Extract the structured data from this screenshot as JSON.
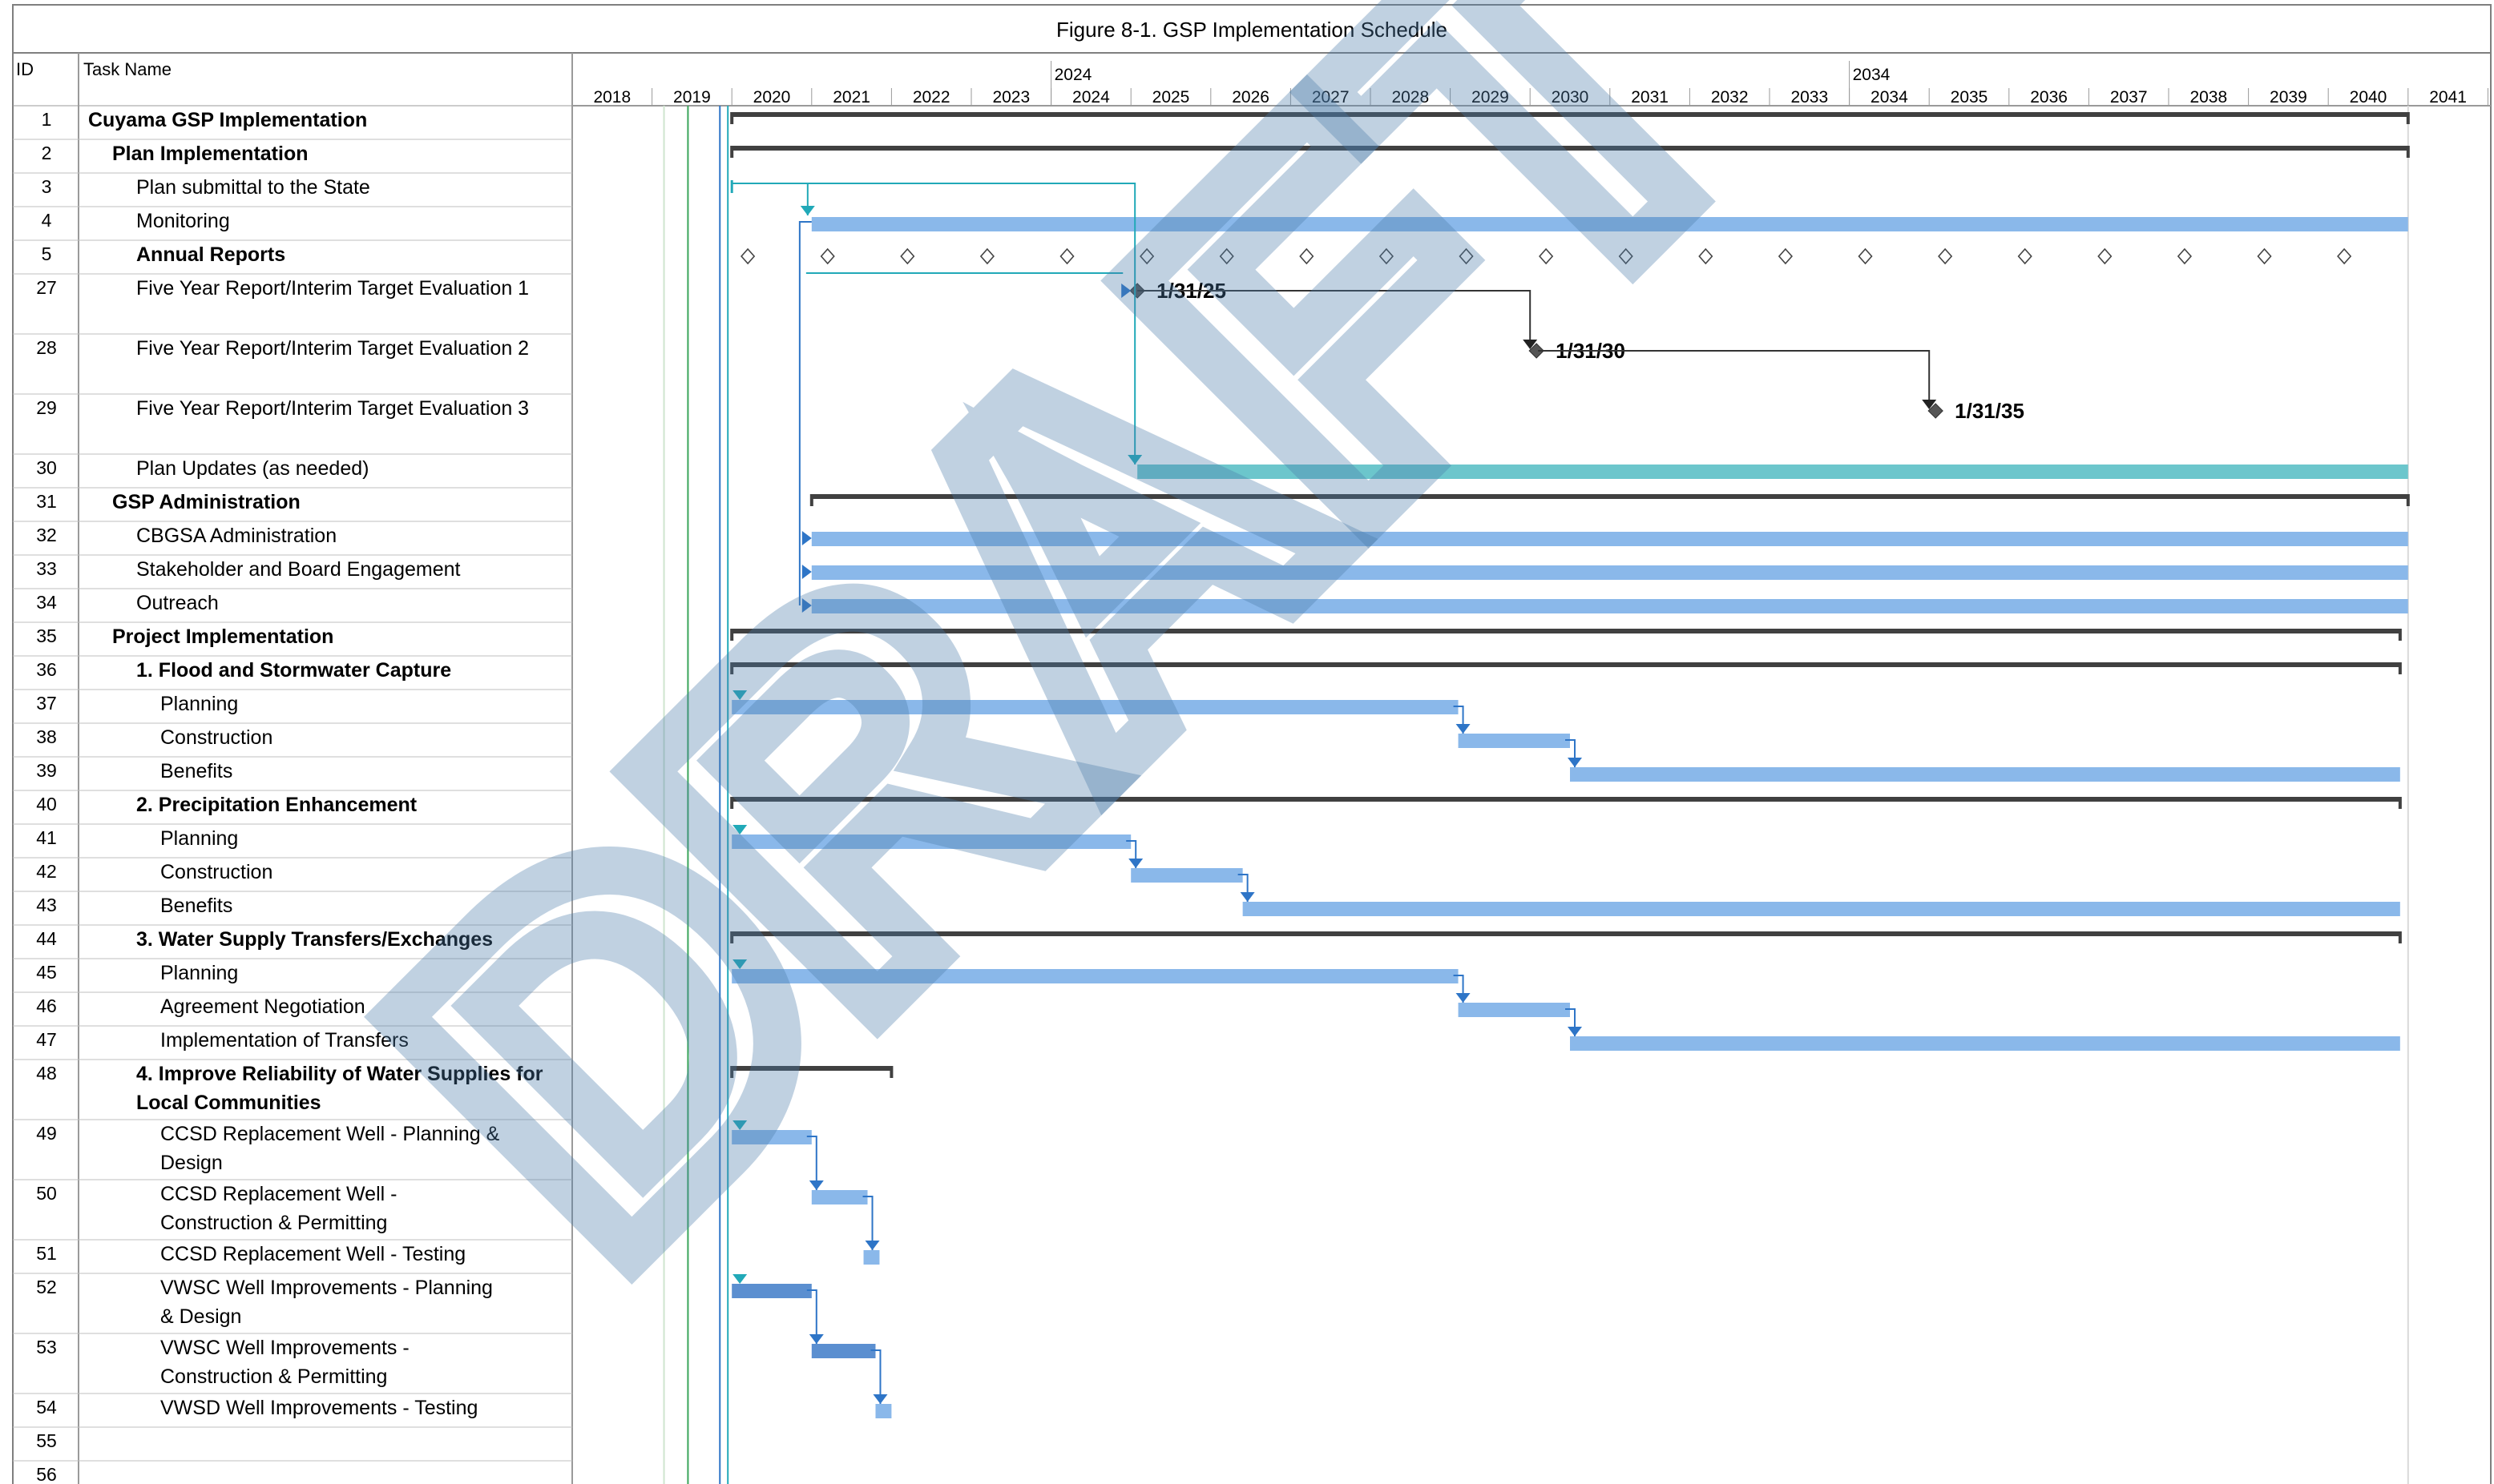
{
  "title": "Figure 8-1. GSP Implementation Schedule",
  "columns": {
    "id": "ID",
    "task_name": "Task Name"
  },
  "timescale": {
    "major": [
      "2024",
      "2034"
    ],
    "years": [
      "2018",
      "2019",
      "2020",
      "2021",
      "2022",
      "2023",
      "2024",
      "2025",
      "2026",
      "2027",
      "2028",
      "2029",
      "2030",
      "2031",
      "2032",
      "2033",
      "2034",
      "2035",
      "2036",
      "2037",
      "2038",
      "2039",
      "2040",
      "2041"
    ]
  },
  "watermark": "DRAFT",
  "colors": {
    "task_bar": "#8ab8ea",
    "task_bar_dark": "#5b8fd0",
    "plan_updates_bar": "#6cc6cc",
    "summary_bar": "#404040",
    "link_blue": "#2e75c7",
    "link_teal": "#21a9b8",
    "milestone": "#555555",
    "watermark": "#4a7aa8",
    "grid": "#bfbfbf"
  },
  "chart_data": {
    "type": "gantt",
    "title": "Figure 8-1. GSP Implementation Schedule",
    "x_range": [
      2018,
      2042
    ],
    "tasks": [
      {
        "id": "1",
        "name": "Cuyama GSP Implementation",
        "bold": true,
        "indent": 0,
        "kind": "summary",
        "start": 2020.0,
        "end": 2041.0
      },
      {
        "id": "2",
        "name": "Plan Implementation",
        "bold": true,
        "indent": 1,
        "kind": "summary",
        "start": 2020.0,
        "end": 2041.0
      },
      {
        "id": "3",
        "name": "Plan submittal to the State",
        "bold": false,
        "indent": 2,
        "kind": "milestone",
        "start": 2020.0,
        "end": 2020.0
      },
      {
        "id": "4",
        "name": "Monitoring",
        "bold": false,
        "indent": 2,
        "kind": "task",
        "start": 2021.0,
        "end": 2041.0
      },
      {
        "id": "5",
        "name": "Annual Reports",
        "bold": true,
        "indent": 2,
        "kind": "recurring",
        "dates": [
          2020.2,
          2021.2,
          2022.2,
          2023.2,
          2024.2,
          2025.2,
          2026.2,
          2027.2,
          2028.2,
          2029.2,
          2030.2,
          2031.2,
          2032.2,
          2033.2,
          2034.2,
          2035.2,
          2036.2,
          2037.2,
          2038.2,
          2039.2,
          2040.2
        ]
      },
      {
        "id": "27",
        "name": "Five Year Report/Interim Target Evaluation 1",
        "bold": false,
        "indent": 2,
        "kind": "milestone",
        "start": 2025.08,
        "end": 2025.08,
        "label": "1/31/25"
      },
      {
        "id": "28",
        "name": "Five Year Report/Interim Target Evaluation 2",
        "bold": false,
        "indent": 2,
        "kind": "milestone",
        "start": 2030.08,
        "end": 2030.08,
        "label": "1/31/30"
      },
      {
        "id": "29",
        "name": "Five Year Report/Interim Target Evaluation 3",
        "bold": false,
        "indent": 2,
        "kind": "milestone",
        "start": 2035.08,
        "end": 2035.08,
        "label": "1/31/35"
      },
      {
        "id": "30",
        "name": "Plan Updates (as needed)",
        "bold": false,
        "indent": 2,
        "kind": "task",
        "start": 2025.08,
        "end": 2041.0,
        "color": "teal"
      },
      {
        "id": "31",
        "name": "GSP Administration",
        "bold": true,
        "indent": 1,
        "kind": "summary",
        "start": 2021.0,
        "end": 2041.0
      },
      {
        "id": "32",
        "name": "CBGSA Administration",
        "bold": false,
        "indent": 2,
        "kind": "task",
        "start": 2021.0,
        "end": 2041.0
      },
      {
        "id": "33",
        "name": "Stakeholder and Board Engagement",
        "bold": false,
        "indent": 2,
        "kind": "task",
        "start": 2021.0,
        "end": 2041.0
      },
      {
        "id": "34",
        "name": "Outreach",
        "bold": false,
        "indent": 2,
        "kind": "task",
        "start": 2021.0,
        "end": 2041.0
      },
      {
        "id": "35",
        "name": "Project Implementation",
        "bold": true,
        "indent": 1,
        "kind": "summary",
        "start": 2020.0,
        "end": 2040.9
      },
      {
        "id": "36",
        "name": "1. Flood and Stormwater Capture",
        "bold": true,
        "indent": 2,
        "kind": "summary",
        "start": 2020.0,
        "end": 2040.9
      },
      {
        "id": "37",
        "name": "Planning",
        "bold": false,
        "indent": 3,
        "kind": "task",
        "start": 2020.0,
        "end": 2029.1
      },
      {
        "id": "38",
        "name": "Construction",
        "bold": false,
        "indent": 3,
        "kind": "task",
        "start": 2029.1,
        "end": 2030.5
      },
      {
        "id": "39",
        "name": "Benefits",
        "bold": false,
        "indent": 3,
        "kind": "task",
        "start": 2030.5,
        "end": 2040.9
      },
      {
        "id": "40",
        "name": "2. Precipitation Enhancement",
        "bold": true,
        "indent": 2,
        "kind": "summary",
        "start": 2020.0,
        "end": 2040.9
      },
      {
        "id": "41",
        "name": "Planning",
        "bold": false,
        "indent": 3,
        "kind": "task",
        "start": 2020.0,
        "end": 2025.0
      },
      {
        "id": "42",
        "name": "Construction",
        "bold": false,
        "indent": 3,
        "kind": "task",
        "start": 2025.0,
        "end": 2026.4
      },
      {
        "id": "43",
        "name": "Benefits",
        "bold": false,
        "indent": 3,
        "kind": "task",
        "start": 2026.4,
        "end": 2040.9
      },
      {
        "id": "44",
        "name": "3. Water Supply Transfers/Exchanges",
        "bold": true,
        "indent": 2,
        "kind": "summary",
        "start": 2020.0,
        "end": 2040.9
      },
      {
        "id": "45",
        "name": "Planning",
        "bold": false,
        "indent": 3,
        "kind": "task",
        "start": 2020.0,
        "end": 2029.1
      },
      {
        "id": "46",
        "name": "Agreement Negotiation",
        "bold": false,
        "indent": 3,
        "kind": "task",
        "start": 2029.1,
        "end": 2030.5
      },
      {
        "id": "47",
        "name": "Implementation of Transfers",
        "bold": false,
        "indent": 3,
        "kind": "task",
        "start": 2030.5,
        "end": 2040.9
      },
      {
        "id": "48",
        "name": "4. Improve Reliability of Water Supplies for Local Communities",
        "bold": true,
        "indent": 2,
        "kind": "summary",
        "start": 2020.0,
        "end": 2022.0
      },
      {
        "id": "49",
        "name": "CCSD Replacement Well - Planning & Design",
        "bold": false,
        "indent": 3,
        "kind": "task",
        "start": 2020.0,
        "end": 2021.0
      },
      {
        "id": "50",
        "name": "CCSD Replacement Well - Construction & Permitting",
        "bold": false,
        "indent": 3,
        "kind": "task",
        "start": 2021.0,
        "end": 2021.7
      },
      {
        "id": "51",
        "name": "CCSD Replacement Well - Testing",
        "bold": false,
        "indent": 3,
        "kind": "task",
        "start": 2021.65,
        "end": 2021.85
      },
      {
        "id": "52",
        "name": "VWSC Well Improvements - Planning & Design",
        "bold": false,
        "indent": 3,
        "kind": "task",
        "start": 2020.0,
        "end": 2021.0,
        "color": "dark"
      },
      {
        "id": "53",
        "name": "VWSC Well Improvements - Construction & Permitting",
        "bold": false,
        "indent": 3,
        "kind": "task",
        "start": 2021.0,
        "end": 2021.8,
        "color": "dark"
      },
      {
        "id": "54",
        "name": "VWSD Well Improvements - Testing",
        "bold": false,
        "indent": 3,
        "kind": "task",
        "start": 2021.8,
        "end": 2022.0
      },
      {
        "id": "55",
        "name": "",
        "bold": false,
        "indent": 0,
        "kind": "empty"
      },
      {
        "id": "56",
        "name": "",
        "bold": false,
        "indent": 0,
        "kind": "empty"
      }
    ]
  }
}
